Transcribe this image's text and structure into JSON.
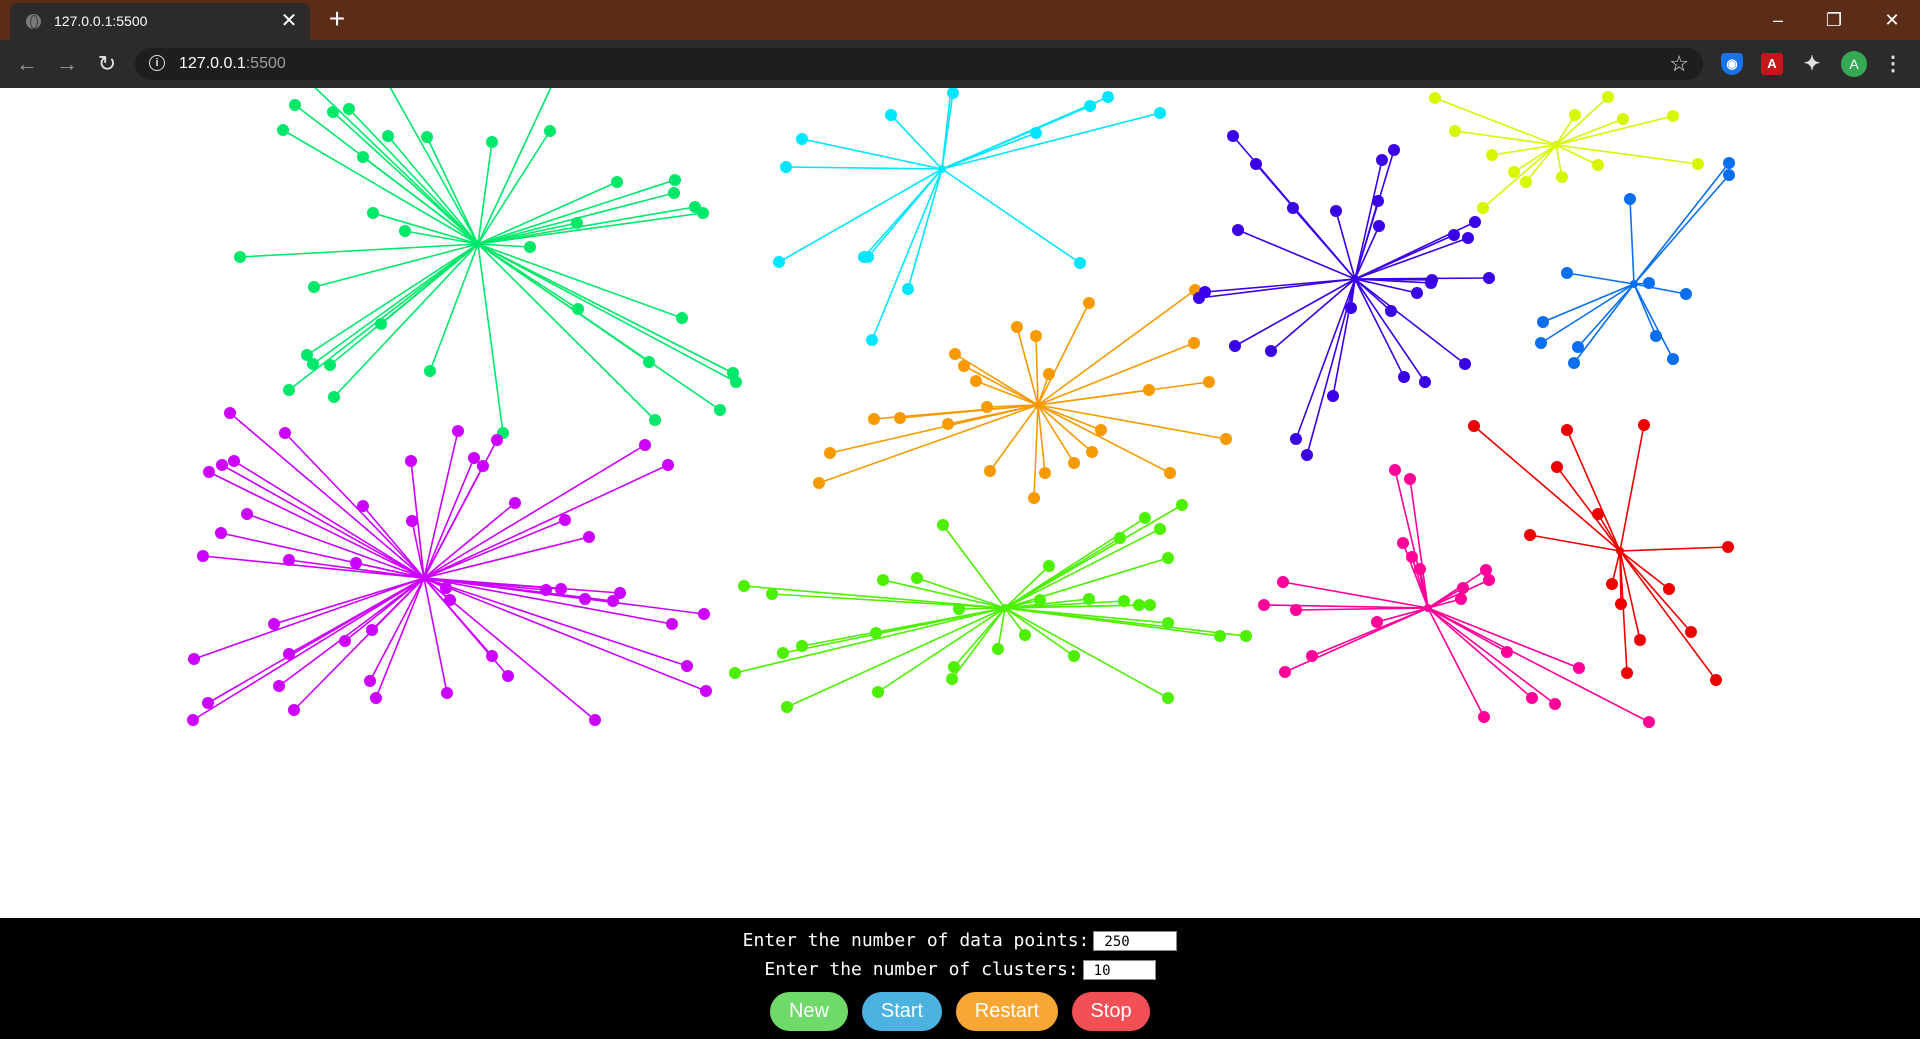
{
  "browser": {
    "tab_title": "127.0.0.1:5500",
    "url_host": "127.0.0.1",
    "url_port": ":5500",
    "profile_initial": "A"
  },
  "icons": [
    "globe-icon",
    "close-icon",
    "plus-icon",
    "minimize-icon",
    "maximize-icon",
    "window-close-icon",
    "back-icon",
    "forward-icon",
    "reload-icon",
    "info-icon",
    "star-icon",
    "shield-extension-icon",
    "pdf-extension-icon",
    "puzzle-icon",
    "avatar",
    "menu-icon"
  ],
  "form": {
    "points_label": "Enter the number of data points:",
    "points_value": "250",
    "clusters_label": "Enter the number of clusters:",
    "clusters_value": "10"
  },
  "buttons": {
    "new": "New",
    "start": "Start",
    "restart": "Restart",
    "stop": "Stop"
  },
  "colors": {
    "btn_new": "#6fd96a",
    "btn_start": "#4cb2e0",
    "btn_restart": "#f8a736",
    "btn_stop": "#f25056"
  },
  "chart_data": {
    "type": "scatter",
    "title": "",
    "xlabel": "",
    "ylabel": "",
    "grid": false,
    "clusters": [
      {
        "color": "#00e86a",
        "centroid": [
          478,
          244
        ],
        "points": [
          [
            278,
            52
          ],
          [
            377,
            64
          ],
          [
            566,
            55
          ],
          [
            295,
            105
          ],
          [
            333,
            112
          ],
          [
            349,
            109
          ],
          [
            283,
            130
          ],
          [
            388,
            136
          ],
          [
            427,
            137
          ],
          [
            492,
            142
          ],
          [
            550,
            131
          ],
          [
            363,
            157
          ],
          [
            617,
            182
          ],
          [
            675,
            180
          ],
          [
            674,
            193
          ],
          [
            695,
            207
          ],
          [
            703,
            213
          ],
          [
            577,
            223
          ],
          [
            373,
            213
          ],
          [
            405,
            231
          ],
          [
            530,
            247
          ],
          [
            240,
            257
          ],
          [
            314,
            287
          ],
          [
            578,
            309
          ],
          [
            682,
            318
          ],
          [
            381,
            324
          ],
          [
            307,
            355
          ],
          [
            313,
            364
          ],
          [
            330,
            365
          ],
          [
            430,
            371
          ],
          [
            733,
            373
          ],
          [
            736,
            382
          ],
          [
            649,
            362
          ],
          [
            289,
            390
          ],
          [
            334,
            397
          ],
          [
            720,
            410
          ],
          [
            655,
            420
          ],
          [
            503,
            433
          ]
        ]
      },
      {
        "color": "#00e6ff",
        "centroid": [
          942,
          169
        ],
        "points": [
          [
            952,
            80
          ],
          [
            953,
            93
          ],
          [
            1108,
            97
          ],
          [
            1090,
            106
          ],
          [
            1160,
            113
          ],
          [
            891,
            115
          ],
          [
            802,
            139
          ],
          [
            1036,
            133
          ],
          [
            786,
            167
          ],
          [
            779,
            262
          ],
          [
            868,
            257
          ],
          [
            864,
            257
          ],
          [
            1080,
            263
          ],
          [
            908,
            289
          ],
          [
            872,
            340
          ]
        ]
      },
      {
        "color": "#f79a00",
        "centroid": [
          1038,
          405
        ],
        "points": [
          [
            1089,
            303
          ],
          [
            1195,
            290
          ],
          [
            1017,
            327
          ],
          [
            1036,
            336
          ],
          [
            955,
            354
          ],
          [
            1194,
            343
          ],
          [
            964,
            366
          ],
          [
            976,
            381
          ],
          [
            1049,
            374
          ],
          [
            1209,
            382
          ],
          [
            1149,
            390
          ],
          [
            987,
            407
          ],
          [
            874,
            419
          ],
          [
            900,
            418
          ],
          [
            1101,
            430
          ],
          [
            948,
            424
          ],
          [
            1226,
            439
          ],
          [
            1092,
            452
          ],
          [
            830,
            453
          ],
          [
            1074,
            463
          ],
          [
            990,
            471
          ],
          [
            1045,
            473
          ],
          [
            1170,
            473
          ],
          [
            819,
            483
          ],
          [
            1034,
            498
          ]
        ]
      },
      {
        "color": "#3a00e8",
        "centroid": [
          1355,
          279
        ],
        "points": [
          [
            1233,
            136
          ],
          [
            1256,
            164
          ],
          [
            1394,
            150
          ],
          [
            1382,
            160
          ],
          [
            1293,
            208
          ],
          [
            1336,
            211
          ],
          [
            1378,
            201
          ],
          [
            1238,
            230
          ],
          [
            1379,
            226
          ],
          [
            1475,
            222
          ],
          [
            1454,
            235
          ],
          [
            1468,
            238
          ],
          [
            1489,
            278
          ],
          [
            1432,
            280
          ],
          [
            1431,
            283
          ],
          [
            1205,
            292
          ],
          [
            1417,
            293
          ],
          [
            1199,
            298
          ],
          [
            1351,
            308
          ],
          [
            1391,
            311
          ],
          [
            1235,
            346
          ],
          [
            1271,
            351
          ],
          [
            1465,
            364
          ],
          [
            1404,
            377
          ],
          [
            1425,
            382
          ],
          [
            1333,
            396
          ],
          [
            1296,
            439
          ],
          [
            1307,
            455
          ]
        ]
      },
      {
        "color": "#d7f700",
        "centroid": [
          1556,
          145
        ],
        "points": [
          [
            1435,
            98
          ],
          [
            1608,
            97
          ],
          [
            1575,
            115
          ],
          [
            1623,
            119
          ],
          [
            1673,
            116
          ],
          [
            1455,
            131
          ],
          [
            1492,
            155
          ],
          [
            1698,
            164
          ],
          [
            1514,
            172
          ],
          [
            1598,
            165
          ],
          [
            1562,
            177
          ],
          [
            1526,
            182
          ],
          [
            1483,
            208
          ]
        ]
      },
      {
        "color": "#0a6ef0",
        "centroid": [
          1634,
          284
        ],
        "points": [
          [
            1729,
            163
          ],
          [
            1729,
            175
          ],
          [
            1630,
            199
          ],
          [
            1567,
            273
          ],
          [
            1649,
            283
          ],
          [
            1686,
            294
          ],
          [
            1543,
            322
          ],
          [
            1656,
            336
          ],
          [
            1541,
            343
          ],
          [
            1578,
            347
          ],
          [
            1574,
            363
          ],
          [
            1673,
            359
          ]
        ]
      },
      {
        "color": "#cc00ff",
        "centroid": [
          424,
          578
        ],
        "points": [
          [
            230,
            413
          ],
          [
            285,
            433
          ],
          [
            458,
            431
          ],
          [
            497,
            440
          ],
          [
            645,
            445
          ],
          [
            234,
            461
          ],
          [
            222,
            465
          ],
          [
            209,
            472
          ],
          [
            411,
            461
          ],
          [
            474,
            458
          ],
          [
            483,
            466
          ],
          [
            668,
            465
          ],
          [
            363,
            506
          ],
          [
            515,
            503
          ],
          [
            247,
            514
          ],
          [
            412,
            521
          ],
          [
            565,
            520
          ],
          [
            221,
            533
          ],
          [
            589,
            537
          ],
          [
            203,
            556
          ],
          [
            289,
            560
          ],
          [
            356,
            563
          ],
          [
            546,
            590
          ],
          [
            561,
            589
          ],
          [
            446,
            588
          ],
          [
            450,
            600
          ],
          [
            585,
            599
          ],
          [
            613,
            601
          ],
          [
            620,
            593
          ],
          [
            704,
            614
          ],
          [
            672,
            624
          ],
          [
            274,
            624
          ],
          [
            345,
            641
          ],
          [
            372,
            630
          ],
          [
            289,
            654
          ],
          [
            194,
            659
          ],
          [
            492,
            656
          ],
          [
            687,
            666
          ],
          [
            279,
            686
          ],
          [
            370,
            681
          ],
          [
            508,
            676
          ],
          [
            706,
            691
          ],
          [
            208,
            703
          ],
          [
            376,
            698
          ],
          [
            447,
            693
          ],
          [
            294,
            710
          ],
          [
            193,
            720
          ],
          [
            595,
            720
          ]
        ]
      },
      {
        "color": "#4cf000",
        "centroid": [
          1005,
          608
        ],
        "points": [
          [
            1182,
            505
          ],
          [
            1145,
            518
          ],
          [
            1160,
            529
          ],
          [
            1120,
            538
          ],
          [
            943,
            525
          ],
          [
            1168,
            558
          ],
          [
            1049,
            566
          ],
          [
            883,
            580
          ],
          [
            917,
            578
          ],
          [
            744,
            586
          ],
          [
            772,
            594
          ],
          [
            1040,
            600
          ],
          [
            1089,
            599
          ],
          [
            1124,
            601
          ],
          [
            1139,
            605
          ],
          [
            1150,
            605
          ],
          [
            959,
            609
          ],
          [
            1168,
            623
          ],
          [
            1220,
            636
          ],
          [
            1246,
            636
          ],
          [
            876,
            633
          ],
          [
            1025,
            635
          ],
          [
            802,
            646
          ],
          [
            783,
            653
          ],
          [
            1074,
            656
          ],
          [
            998,
            649
          ],
          [
            954,
            667
          ],
          [
            735,
            673
          ],
          [
            952,
            679
          ],
          [
            878,
            692
          ],
          [
            787,
            707
          ],
          [
            1168,
            698
          ]
        ]
      },
      {
        "color": "#ff0099",
        "centroid": [
          1428,
          608
        ],
        "points": [
          [
            1395,
            470
          ],
          [
            1410,
            479
          ],
          [
            1403,
            543
          ],
          [
            1412,
            557
          ],
          [
            1420,
            569
          ],
          [
            1486,
            570
          ],
          [
            1489,
            580
          ],
          [
            1283,
            582
          ],
          [
            1463,
            588
          ],
          [
            1461,
            599
          ],
          [
            1264,
            605
          ],
          [
            1296,
            610
          ],
          [
            1377,
            622
          ],
          [
            1507,
            652
          ],
          [
            1312,
            656
          ],
          [
            1579,
            668
          ],
          [
            1285,
            672
          ],
          [
            1532,
            698
          ],
          [
            1555,
            704
          ],
          [
            1484,
            717
          ],
          [
            1649,
            722
          ]
        ]
      },
      {
        "color": "#ee0000",
        "centroid": [
          1620,
          551
        ],
        "points": [
          [
            1474,
            426
          ],
          [
            1567,
            430
          ],
          [
            1644,
            425
          ],
          [
            1557,
            467
          ],
          [
            1598,
            514
          ],
          [
            1530,
            535
          ],
          [
            1728,
            547
          ],
          [
            1612,
            584
          ],
          [
            1669,
            589
          ],
          [
            1621,
            604
          ],
          [
            1691,
            632
          ],
          [
            1640,
            640
          ],
          [
            1627,
            673
          ],
          [
            1716,
            680
          ]
        ]
      }
    ]
  }
}
